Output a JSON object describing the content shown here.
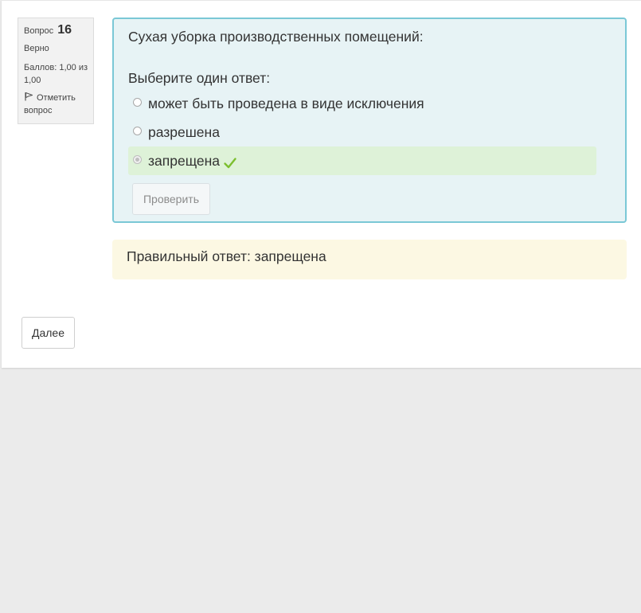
{
  "question_info": {
    "number_label": "Вопрос",
    "number": "16",
    "state": "Верно",
    "grade": "Баллов: 1,00 из 1,00",
    "flag_label": "Отметить вопрос",
    "flag_icon": "flag-icon"
  },
  "formulation": {
    "question_text": "Сухая уборка производственных помещений:",
    "prompt": "Выберите один ответ:",
    "answers": [
      {
        "label": "может быть проведена в виде исключения",
        "selected": false,
        "correct": false
      },
      {
        "label": "разрешена",
        "selected": false,
        "correct": false
      },
      {
        "label": "запрещена",
        "selected": true,
        "correct": true,
        "icon": "checkmark-icon"
      }
    ],
    "check_button": "Проверить"
  },
  "feedback": {
    "right_answer": "Правильный ответ: запрещена"
  },
  "navigation": {
    "next_button": "Далее"
  },
  "colors": {
    "formulation_bg": "#e7f3f5",
    "formulation_border": "#7ac8d6",
    "correct_bg": "#def2d8",
    "checkmark": "#7cbf2f",
    "feedback_bg": "#fcf8e3",
    "page_bg": "#ebebeb"
  }
}
